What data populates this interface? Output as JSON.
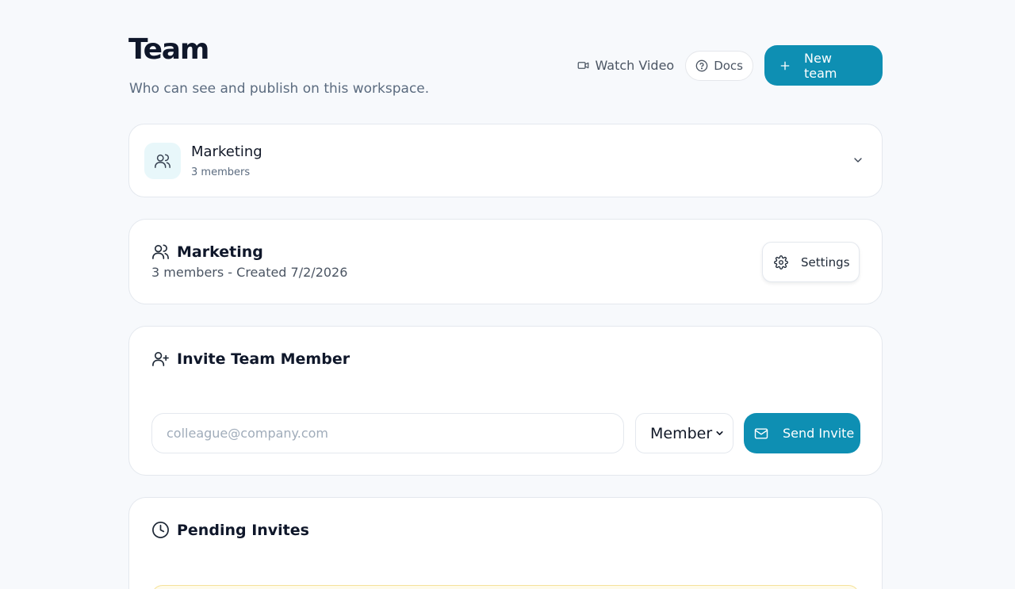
{
  "header": {
    "title": "Team",
    "subtitle": "Who can see and publish on this workspace.",
    "watch_video_label": "Watch Video",
    "docs_label": "Docs",
    "new_team_label": "New team"
  },
  "team_selector": {
    "name": "Marketing",
    "count": "3 members"
  },
  "team_info": {
    "name": "Marketing",
    "meta": "3 members - Created 7/2/2026",
    "settings_label": "Settings"
  },
  "invite": {
    "title": "Invite Team Member",
    "email_placeholder": "colleague@company.com",
    "role_value": "Member",
    "send_label": "Send Invite"
  },
  "pending": {
    "title": "Pending Invites"
  },
  "colors": {
    "accent": "#0e8fb3",
    "background": "#f7f9fc",
    "icon_tint": "#e8f7fa",
    "pending_strip": "#fffbea"
  }
}
